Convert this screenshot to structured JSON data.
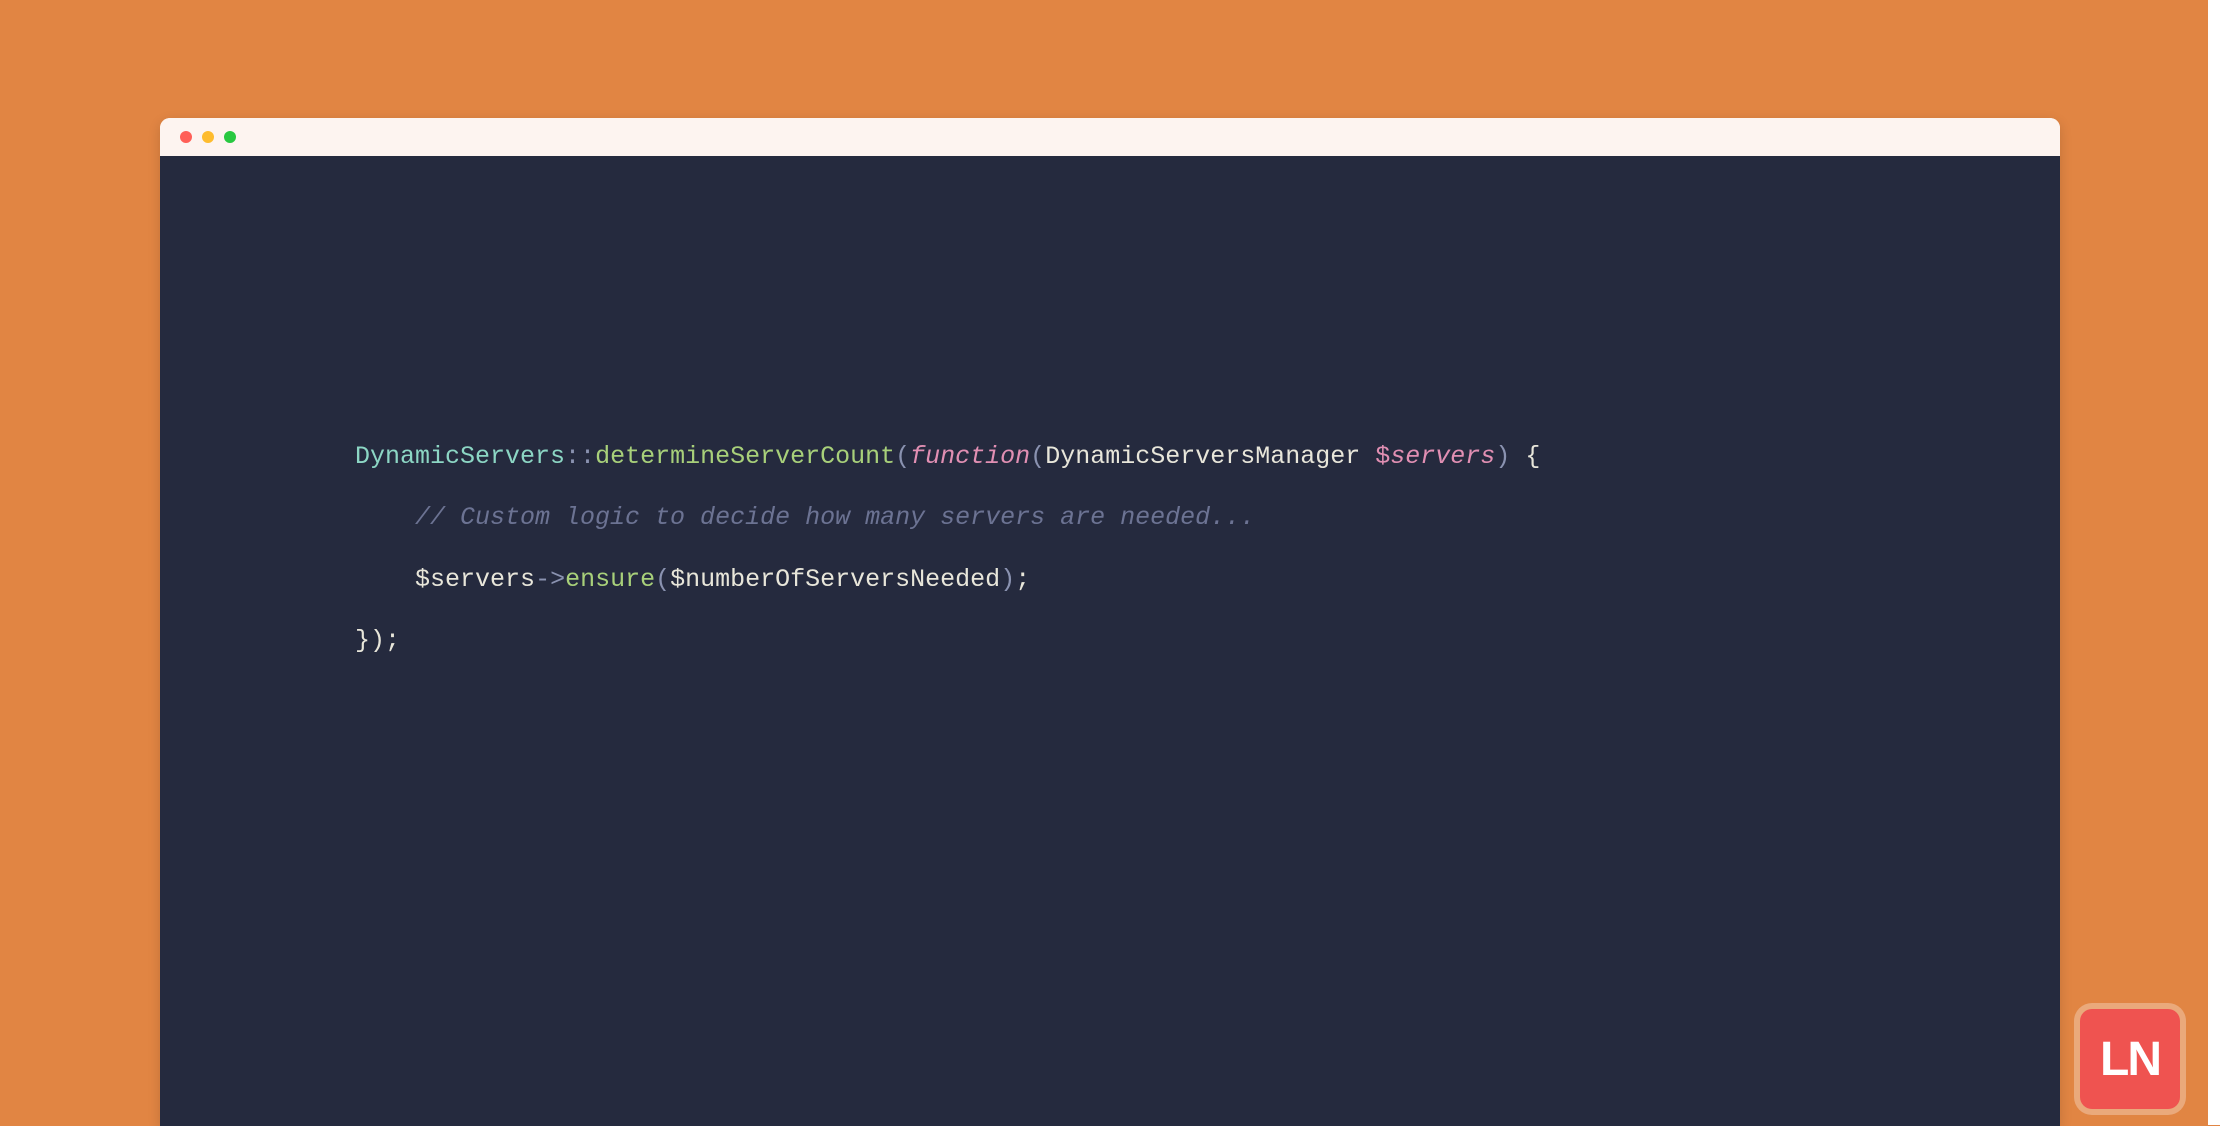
{
  "code": {
    "line1": {
      "class": "DynamicServers",
      "scope": "::",
      "method": "determineServerCount",
      "openParen": "(",
      "keyword": "function",
      "innerOpenParen": "(",
      "type": "DynamicServersManager",
      "space": " ",
      "dollar": "$",
      "var": "servers",
      "closeParen": ")",
      "brace": " {"
    },
    "line2": {
      "indent": "    ",
      "comment": "// Custom logic to decide how many servers are needed..."
    },
    "line3": {
      "indent": "    ",
      "dollar1": "$",
      "var1": "servers",
      "arrow": "->",
      "method": "ensure",
      "openParen": "(",
      "dollar2": "$",
      "arg": "numberOfServersNeeded",
      "closeParen": ")",
      "semi": ";"
    },
    "line4": {
      "closing": "});"
    }
  },
  "logo": {
    "text": "LN"
  }
}
